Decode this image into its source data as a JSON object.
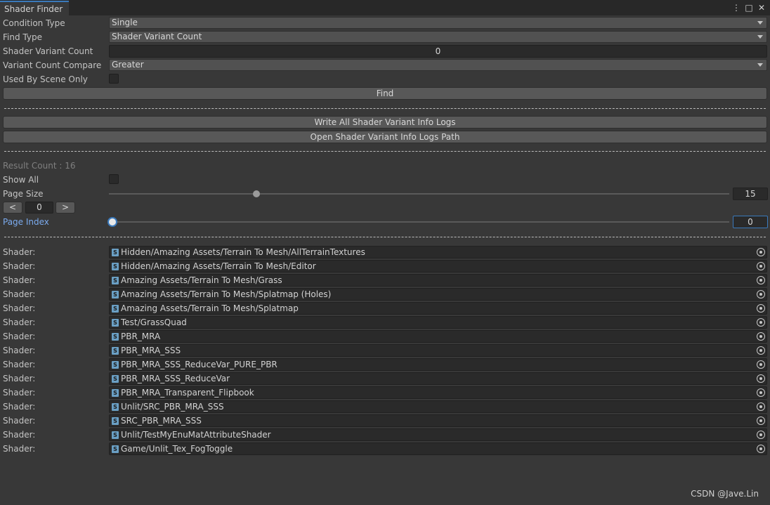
{
  "window": {
    "tab_title": "Shader Finder",
    "controls": [
      "more-icon",
      "maximize-icon",
      "close-icon"
    ]
  },
  "form": {
    "condition_type": {
      "label": "Condition Type",
      "value": "Single"
    },
    "find_type": {
      "label": "Find Type",
      "value": "Shader Variant Count"
    },
    "shader_variant_count": {
      "label": "Shader Variant Count",
      "value": "0"
    },
    "variant_count_compare": {
      "label": "Variant Count Compare",
      "value": "Greater"
    },
    "used_by_scene_only": {
      "label": "Used By Scene Only",
      "checked": false
    },
    "find_button": "Find"
  },
  "actions": {
    "write_logs": "Write All Shader Variant Info Logs",
    "open_logs_path": "Open Shader Variant Info Logs Path"
  },
  "results": {
    "result_count": "Result Count : 16",
    "show_all": {
      "label": "Show All",
      "checked": false
    },
    "page_size": {
      "label": "Page Size",
      "value": "15",
      "min": 1,
      "max": 60
    },
    "pager": {
      "prev": "<",
      "page": "0",
      "next": ">"
    },
    "page_index": {
      "label": "Page Index",
      "value": "0"
    },
    "row_label": "Shader:",
    "shaders": [
      "Hidden/Amazing Assets/Terrain To Mesh/AllTerrainTextures",
      "Hidden/Amazing Assets/Terrain To Mesh/Editor",
      "Amazing Assets/Terrain To Mesh/Grass",
      "Amazing Assets/Terrain To Mesh/Splatmap (Holes)",
      "Amazing Assets/Terrain To Mesh/Splatmap",
      "Test/GrassQuad",
      "PBR_MRA",
      "PBR_MRA_SSS",
      "PBR_MRA_SSS_ReduceVar_PURE_PBR",
      "PBR_MRA_SSS_ReduceVar",
      "PBR_MRA_Transparent_Flipbook",
      "Unlit/SRC_PBR_MRA_SSS",
      "SRC_PBR_MRA_SSS",
      "Unlit/TestMyEnuMatAttributeShader",
      "Game/Unlit_Tex_FogToggle"
    ]
  },
  "watermark": "CSDN @Jave.Lin",
  "colors": {
    "background": "#383838",
    "accent": "#3a79bb",
    "field": "#2a2a2a",
    "button": "#585858"
  }
}
